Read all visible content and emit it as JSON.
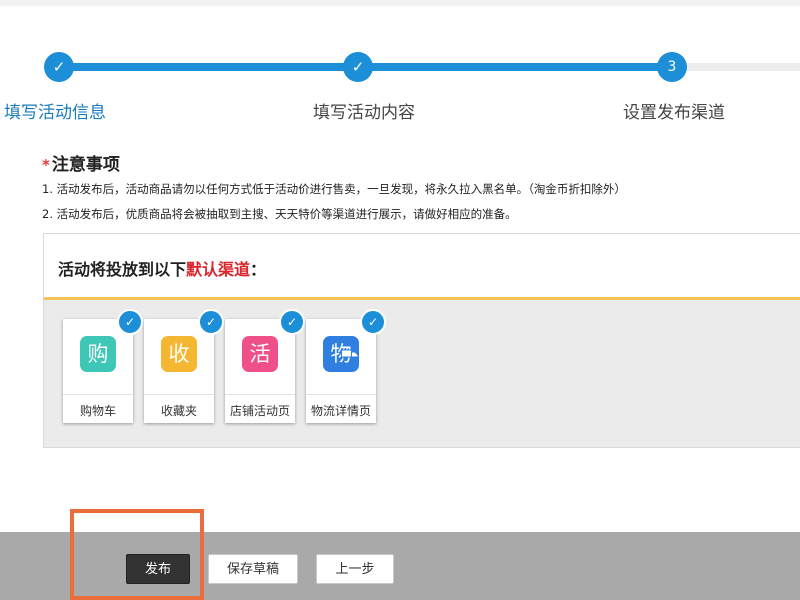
{
  "steps": [
    {
      "label": "填写活动信息",
      "marker": "✓",
      "state": "done"
    },
    {
      "label": "填写活动内容",
      "marker": "✓",
      "state": "done"
    },
    {
      "label": "设置发布渠道",
      "marker": "3",
      "state": "current"
    }
  ],
  "notice": {
    "star": "*",
    "title": "注意事项",
    "items": [
      "1.  活动发布后，活动商品请勿以任何方式低于活动价进行售卖，一旦发现，将永久拉入黑名单。（淘金币折扣除外）",
      "2.  活动发布后，优质商品将会被抽取到主搜、天天特价等渠道进行展示，请做好相应的准备。"
    ]
  },
  "channel": {
    "title_prefix": "活动将投放到以下",
    "title_highlight": "默认渠道",
    "title_suffix": "：",
    "cards": [
      {
        "icon_char": "购",
        "label": "购物车",
        "color": "#3ec6b6",
        "checked": true,
        "icon": "shopping-cart-icon"
      },
      {
        "icon_char": "收",
        "label": "收藏夹",
        "color": "#f5b731",
        "checked": true,
        "icon": "favorites-icon"
      },
      {
        "icon_char": "活",
        "label": "店铺活动页",
        "color": "#f0508a",
        "checked": true,
        "icon": "store-activity-icon"
      },
      {
        "icon_char": "物",
        "label": "物流详情页",
        "color": "#2f7fe0",
        "checked": true,
        "icon": "logistics-icon"
      }
    ]
  },
  "footer": {
    "publish": "发布",
    "save_draft": "保存草稿",
    "prev": "上一步"
  },
  "colors": {
    "accent": "#1d8ed8",
    "highlight_text": "#d9262c",
    "annotation": "#ec6d3c"
  }
}
